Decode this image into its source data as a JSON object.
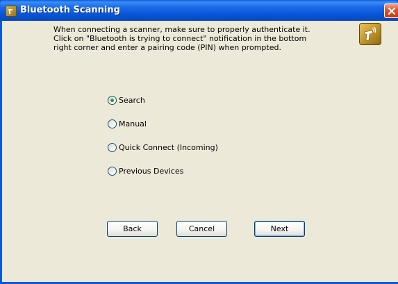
{
  "window": {
    "title": "Bluetooth Scanning"
  },
  "intro": {
    "lines": [
      "When connecting a scanner, make sure to properly authenticate it.",
      "Click on \"Bluetooth is trying to connect\" notification in the bottom",
      "right corner and enter a pairing code (PIN) when prompted."
    ]
  },
  "options": [
    {
      "label": "Search",
      "selected": true
    },
    {
      "label": "Manual",
      "selected": false
    },
    {
      "label": "Quick Connect (Incoming)",
      "selected": false
    },
    {
      "label": "Previous Devices",
      "selected": false
    }
  ],
  "buttons": {
    "back": "Back",
    "cancel": "Cancel",
    "next": "Next"
  },
  "colors": {
    "titlebar": "#0a5ad8",
    "client_bg": "#ece9d8",
    "radio_dot": "#21a121",
    "close_button": "#e4582f",
    "logo_gold": "#c79a2c"
  },
  "icons": {
    "title": "scanner-app-icon",
    "logo": "bluetooth-scanner-icon",
    "close": "close-icon"
  }
}
